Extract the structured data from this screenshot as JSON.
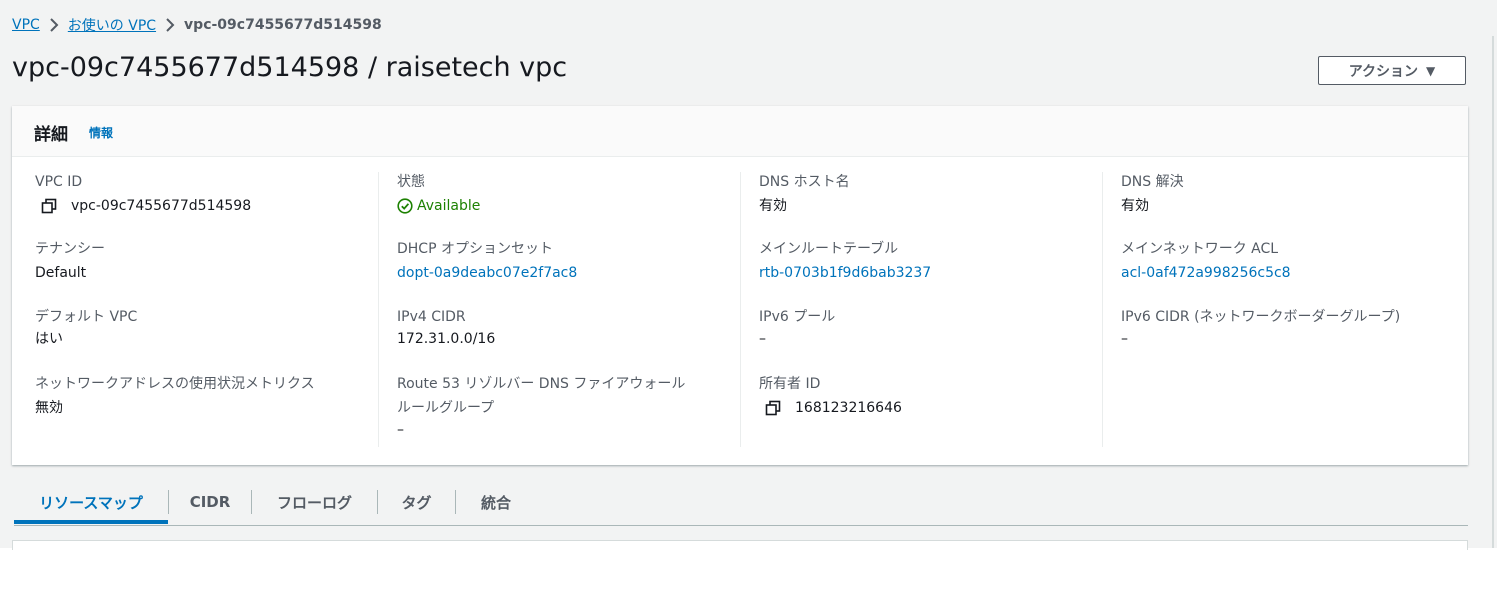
{
  "breadcrumb": {
    "items": [
      "VPC",
      "お使いの VPC"
    ],
    "current": "vpc-09c7455677d514598"
  },
  "page": {
    "title": "vpc-09c7455677d514598 / raisetech vpc",
    "action_label": "アクション"
  },
  "details": {
    "title": "詳細",
    "info_label": "情報",
    "col1": {
      "vpc_id_label": "VPC ID",
      "vpc_id_value": "vpc-09c7455677d514598",
      "tenancy_label": "テナンシー",
      "tenancy_value": "Default",
      "default_vpc_label": "デフォルト VPC",
      "default_vpc_value": "はい",
      "network_metrics_label": "ネットワークアドレスの使用状況メトリクス",
      "network_metrics_value": "無効"
    },
    "col2": {
      "state_label": "状態",
      "state_value": "Available",
      "dhcp_label": "DHCP オプションセット",
      "dhcp_value": "dopt-0a9deabc07e2f7ac8",
      "ipv4_label": "IPv4 CIDR",
      "ipv4_value": "172.31.0.0/16",
      "route53_label_line1": "Route 53 リゾルバー DNS ファイアウォール",
      "route53_label_line2": "ルールグループ",
      "route53_value": "–"
    },
    "col3": {
      "dns_hostname_label": "DNS ホスト名",
      "dns_hostname_value": "有効",
      "main_route_label": "メインルートテーブル",
      "main_route_value": "rtb-0703b1f9d6bab3237",
      "ipv6_pool_label": "IPv6 プール",
      "ipv6_pool_value": "–",
      "owner_label": "所有者 ID",
      "owner_value": "168123216646"
    },
    "col4": {
      "dns_resolution_label": "DNS 解決",
      "dns_resolution_value": "有効",
      "main_acl_label": "メインネットワーク ACL",
      "main_acl_value": "acl-0af472a998256c5c8",
      "ipv6_cidr_label": "IPv6 CIDR (ネットワークボーダーグループ)",
      "ipv6_cidr_value": "–"
    }
  },
  "tabs": [
    "リソースマップ",
    "CIDR",
    "フローログ",
    "タグ",
    "統合"
  ],
  "active_tab": "リソースマップ",
  "colors": {
    "link": "#0073bb",
    "success": "#1d8102",
    "text": "#16191f",
    "muted": "#545b64",
    "background": "#f2f3f3"
  },
  "icons": [
    "chevron-right-icon",
    "copy-icon",
    "status-ok-icon",
    "caret-down-icon"
  ]
}
